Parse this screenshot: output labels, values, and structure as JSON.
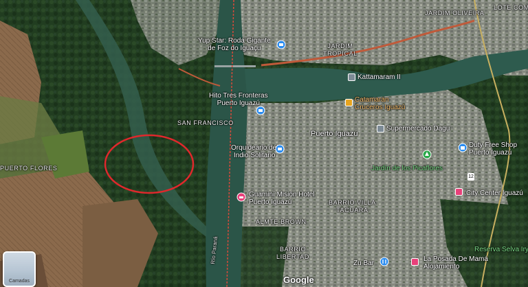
{
  "map": {
    "places": {
      "yup_star": "Yup Star: Roda Gigante\nde Foz do Iguaçu",
      "jardim_tropical": "JARDIM\nTROPICAL",
      "jardim_oliveira": "JARDIM OLIVEIRA",
      "lote_comercial": "LOTE COMERCIAL",
      "kattamaram": "Kattamaram II",
      "hito": "Hito Tres Fronteras\nPuerto Iguazú",
      "catamaran": "Catamaran\nCruceros Iguazú",
      "san_francisco": "SAN FRANCISCO",
      "supermercado": "Supermercado Dagu",
      "puerto_iguazu": "Puerto Iguazú",
      "orquideario": "Orquideario del\nIndio Solitario",
      "duty_free": "Duty Free Shop\nPuerto Iguazú",
      "jardin_picaflores": "Jardín de los Picaflores",
      "puerto_flores": "PUERTO FLORES",
      "guamini": "Guaminí Misión Hotel\nPuerto Iguazú",
      "barrio_villa": "BARRIO VILLA\nTACUARA",
      "city_center": "City Center Iguazú",
      "almte_brown": "ALMTE BROWN",
      "barrio_libertad": "BARRIO\nLIBERTAD",
      "reserva": "Reserva Selva Iryapú",
      "la_posada": "La Posada De Mamá\nAlojamiento",
      "zu_bar": "Zu Bar",
      "rio_parana": "Río Paraná",
      "route_12": "12"
    },
    "ui": {
      "layers_label": "Camadas",
      "google_logo": "Google"
    },
    "icons": {
      "camera_pin": "camera-icon",
      "hotel_pin": "hotel-icon",
      "shopping_pin": "shopping-bag-icon",
      "park_pin": "tree-icon",
      "food_pin": "fork-knife-icon",
      "square_poi": "building-icon"
    },
    "colors": {
      "river": "#2e5b4e",
      "forest": "#1f3a1f",
      "farmland": "#8a6a4a",
      "urban": "#7b7f7c",
      "highlight_circle": "#e0282c",
      "pin_blue": "#2a8cf0",
      "pin_pink": "#e8407a",
      "pin_green": "#2aa84a",
      "pin_orange": "#e8a420"
    }
  }
}
